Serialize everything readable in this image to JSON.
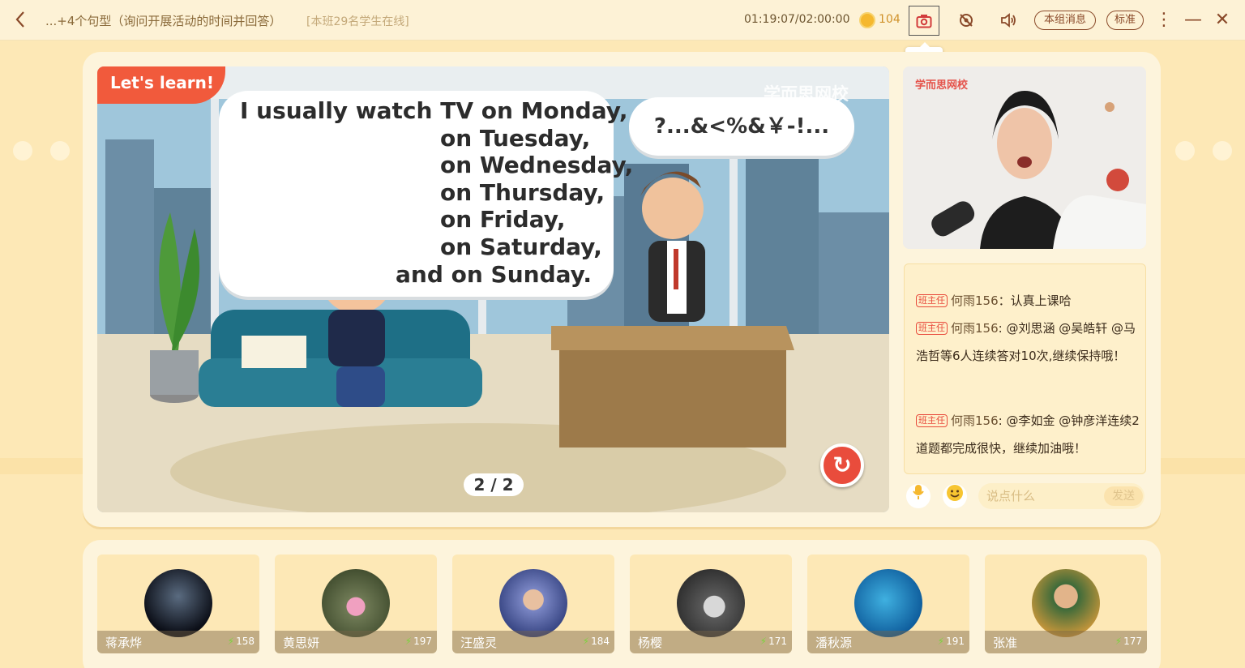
{
  "header": {
    "title": "...+4个句型（询问开展活动的时间并回答）",
    "online_status": "[本班29名学生在线]",
    "timer": "01:19:07/02:00:00",
    "coins": "104",
    "screenshot_tooltip": "截屏",
    "group_message_label": "本组消息",
    "quality_label": "标准"
  },
  "slide": {
    "badge": "Let's learn!",
    "watermark": "学而思网校",
    "sentence_lines": [
      "I usually watch TV on Monday,",
      "on Tuesday,",
      "on Wednesday,",
      "on Thursday,",
      "on Friday,",
      "on Saturday,",
      "and on Sunday."
    ],
    "reply_bubble": "?...&<%&￥-!...",
    "pager": "2 / 2"
  },
  "video": {
    "watermark": "学而思网校"
  },
  "chat": {
    "messages": [
      {
        "role": "班主任",
        "sender": "何雨156",
        "text": "：认真上课哈"
      },
      {
        "role": "班主任",
        "sender": "何雨156",
        "text": ": @刘思涵 @吴皓轩 @马浩哲等6人连续答对10次,继续保持哦！"
      },
      {
        "role": "班主任",
        "sender": "何雨156",
        "text": ": @李如金 @钟彦洋连续2道题都完成很快，继续加油哦！"
      }
    ],
    "input_placeholder": "说点什么",
    "send_label": "发送"
  },
  "students": [
    {
      "name": "蒋承烨",
      "score": "158"
    },
    {
      "name": "黄思妍",
      "score": "197"
    },
    {
      "name": "汪盛灵",
      "score": "184"
    },
    {
      "name": "杨樱",
      "score": "171"
    },
    {
      "name": "潘秋源",
      "score": "191"
    },
    {
      "name": "张准",
      "score": "177"
    }
  ],
  "colors": {
    "background": "#fde8b6",
    "panel": "#fdf4dc",
    "accent_red": "#e84b3c",
    "brand_brown": "#8a4a2a"
  },
  "icons": [
    "back-icon",
    "coin-icon",
    "camera-icon",
    "no-camera-icon",
    "speaker-icon",
    "more-icon",
    "minimize-icon",
    "close-icon",
    "replay-icon",
    "mic-icon",
    "emoji-icon",
    "lightning-icon"
  ]
}
